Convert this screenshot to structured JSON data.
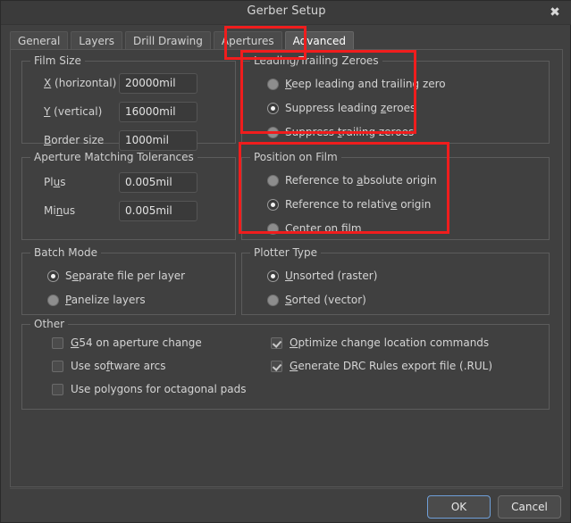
{
  "window": {
    "title": "Gerber Setup",
    "close_icon": "close-icon"
  },
  "tabs": [
    {
      "label": "General",
      "active": false
    },
    {
      "label": "Layers",
      "active": false
    },
    {
      "label": "Drill Drawing",
      "active": false
    },
    {
      "label": "Apertures",
      "active": false
    },
    {
      "label": "Advanced",
      "active": true
    }
  ],
  "groups": {
    "film_size": {
      "title": "Film Size",
      "fields": [
        {
          "label_pre": "",
          "label_key": "X",
          "label_post": " (horizontal)",
          "value": "20000mil"
        },
        {
          "label_pre": "",
          "label_key": "Y",
          "label_post": " (vertical)",
          "value": "16000mil"
        },
        {
          "label_pre": "",
          "label_key": "B",
          "label_post": "order size",
          "value": "1000mil"
        }
      ]
    },
    "aperture_tolerances": {
      "title": "Aperture Matching Tolerances",
      "fields": [
        {
          "label_pre": "Pl",
          "label_key": "u",
          "label_post": "s",
          "value": "0.005mil"
        },
        {
          "label_pre": "Mi",
          "label_key": "n",
          "label_post": "us",
          "value": "0.005mil"
        }
      ]
    },
    "leading_trailing_zeroes": {
      "title": "Leading/Trailing Zeroes",
      "options": [
        {
          "pre": "",
          "key": "K",
          "post": "eep leading and trailing zero",
          "checked": false
        },
        {
          "pre": "Suppress leading ",
          "key": "z",
          "post": "eroes",
          "checked": true
        },
        {
          "pre": "Suppress ",
          "key": "t",
          "post": "railing zeroes",
          "checked": false
        }
      ]
    },
    "position_on_film": {
      "title": "Position on Film",
      "options": [
        {
          "pre": "Reference to ",
          "key": "a",
          "post": "bsolute origin",
          "checked": false
        },
        {
          "pre": "Reference to relativ",
          "key": "e",
          "post": " origin",
          "checked": true
        },
        {
          "pre": "",
          "key": "C",
          "post": "enter on film",
          "checked": false
        }
      ]
    },
    "batch_mode": {
      "title": "Batch Mode",
      "options": [
        {
          "pre": "S",
          "key": "e",
          "post": "parate file per layer",
          "checked": true
        },
        {
          "pre": "",
          "key": "P",
          "post": "anelize layers",
          "checked": false
        }
      ]
    },
    "plotter_type": {
      "title": "Plotter Type",
      "options": [
        {
          "pre": "",
          "key": "U",
          "post": "nsorted (raster)",
          "checked": true
        },
        {
          "pre": "",
          "key": "S",
          "post": "orted (vector)",
          "checked": false
        }
      ]
    },
    "other": {
      "title": "Other",
      "left_options": [
        {
          "pre": "",
          "key": "G",
          "post": "54 on aperture change",
          "checked": false
        },
        {
          "pre": "Use so",
          "key": "f",
          "post": "tware arcs",
          "checked": false
        },
        {
          "pre": "Use polygons for octagonal pads",
          "key": "",
          "post": "",
          "checked": false
        }
      ],
      "right_options": [
        {
          "pre": "",
          "key": "O",
          "post": "ptimize change location commands",
          "checked": true
        },
        {
          "pre": "",
          "key": "G",
          "post": "enerate DRC Rules export file (.RUL)",
          "checked": true
        }
      ]
    }
  },
  "footer": {
    "ok_label": "OK",
    "cancel_label": "Cancel"
  },
  "annotations": {
    "accent_color": "#f01d1d",
    "regions": [
      {
        "name": "advanced-tab-highlight"
      },
      {
        "name": "leading-trailing-zeroes-highlight"
      },
      {
        "name": "position-on-film-highlight"
      }
    ]
  }
}
